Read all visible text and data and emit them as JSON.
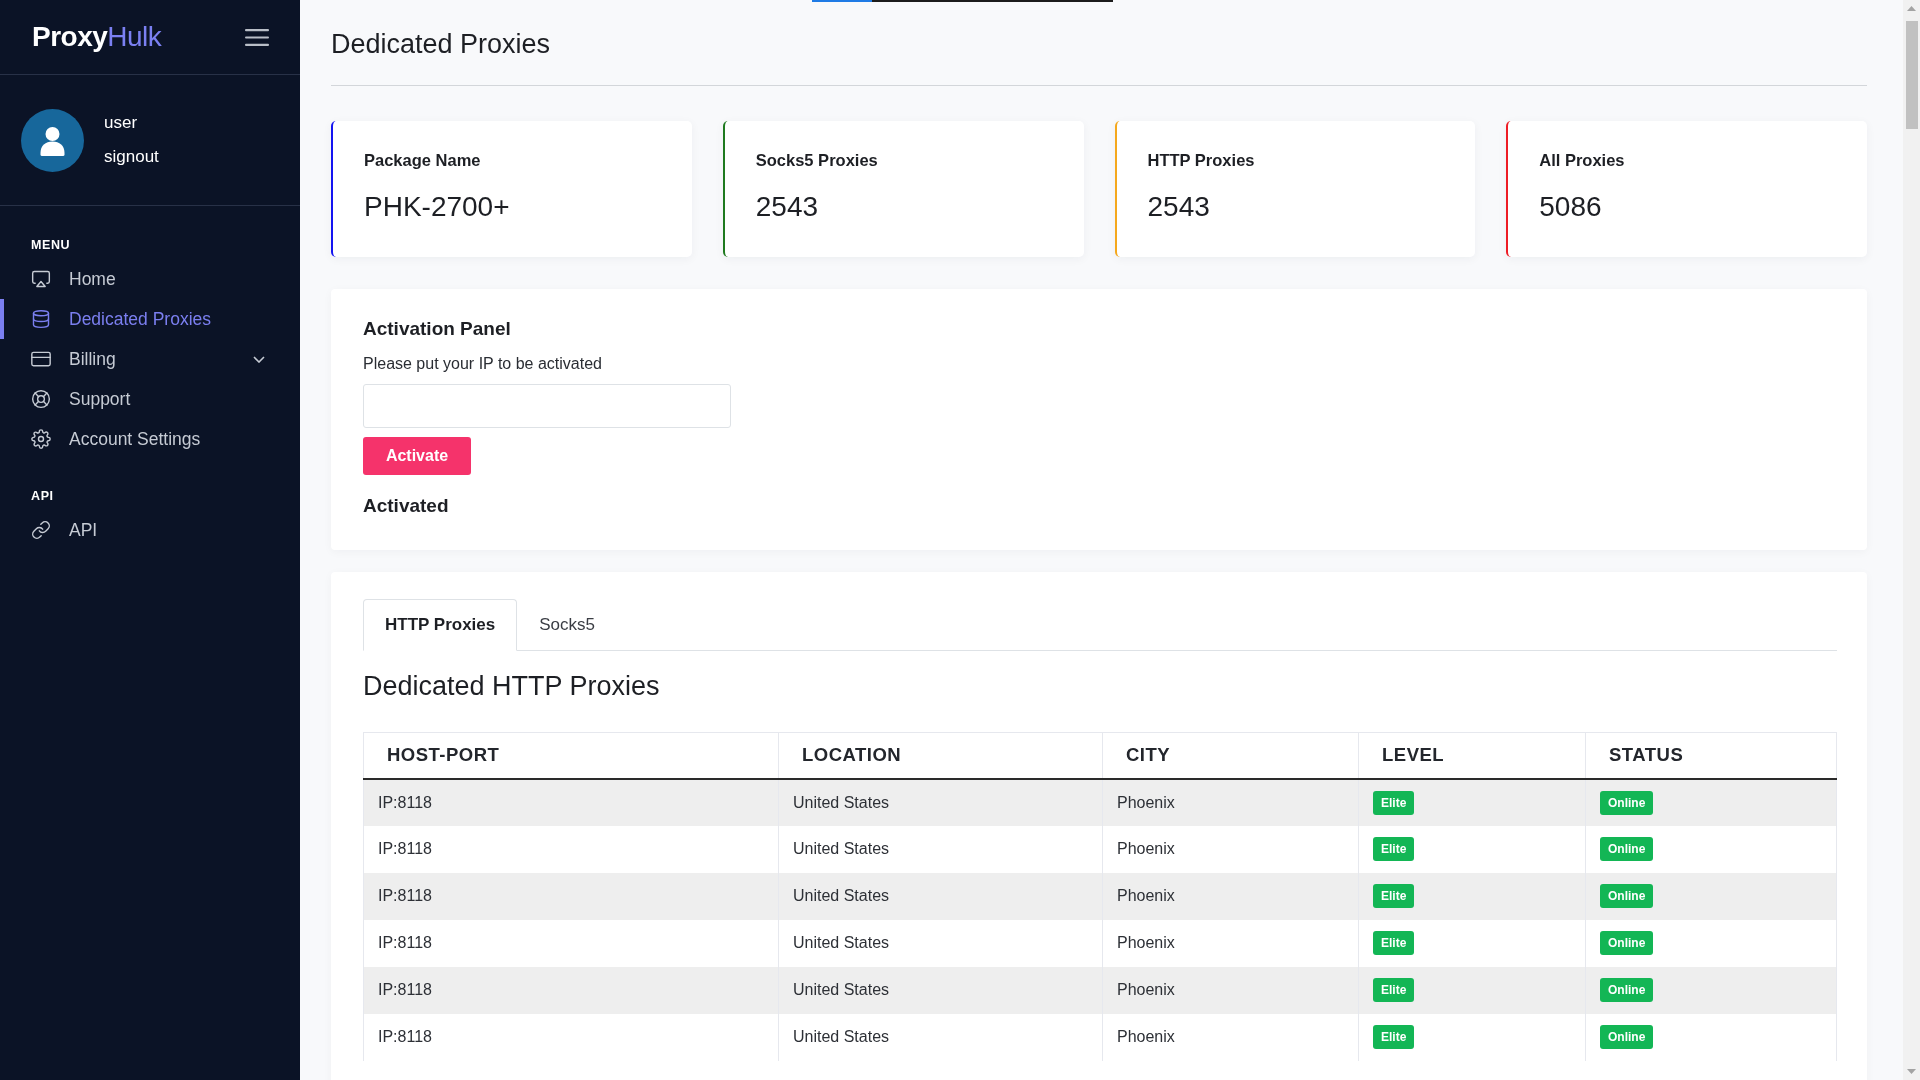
{
  "loading_bar": {
    "level": 0.2
  },
  "sidebar": {
    "logo": "**Proxy**Hulk",
    "user": {
      "name": "user",
      "signout": "signout"
    },
    "sections": [
      {
        "heading": "MENU",
        "items": [
          {
            "label": "Home",
            "kind": "link",
            "selected": false
          },
          {
            "label": "Dedicated Proxies",
            "kind": "link",
            "selected": true
          },
          {
            "label": "Billing",
            "kind": "group",
            "selected": false
          },
          {
            "label": "Support",
            "kind": "link",
            "selected": false
          },
          {
            "label": "Account Settings",
            "kind": "link",
            "selected": false
          }
        ]
      },
      {
        "heading": "API",
        "items": [
          {
            "label": "API",
            "kind": "link",
            "selected": false
          }
        ]
      }
    ]
  },
  "header": {
    "title": "Dedicated Proxies"
  },
  "stats": [
    {
      "label": "Package Name",
      "value": "PHK-2700+",
      "color": "#1414f0"
    },
    {
      "label": "Socks5 Proxies",
      "value": "2543",
      "color": "#1f7a1f"
    },
    {
      "label": "HTTP Proxies",
      "value": "2543",
      "color": "#f5a81c"
    },
    {
      "label": "All Proxies",
      "value": "5086",
      "color": "#ee1c25"
    }
  ],
  "activation_panel": {
    "title": "Activation Panel",
    "instruction": "Please put your IP to be activated",
    "button": "Activate",
    "status": "Activated"
  },
  "proxies_panel": {
    "tabs": [
      {
        "label": "HTTP Proxies",
        "selected": true
      },
      {
        "label": "Socks5",
        "selected": false
      }
    ],
    "title": "Dedicated HTTP Proxies",
    "table": {
      "columns": [
        "HOST-PORT",
        "LOCATION",
        "CITY",
        "LEVEL",
        "STATUS"
      ],
      "rows": [
        {
          "host_port": "IP:8118",
          "location": "United States",
          "city": "Phoenix",
          "level_badge": "Elite",
          "status_badge": "Online"
        },
        {
          "host_port": "IP:8118",
          "location": "United States",
          "city": "Phoenix",
          "level_badge": "Elite",
          "status_badge": "Online"
        },
        {
          "host_port": "IP:8118",
          "location": "United States",
          "city": "Phoenix",
          "level_badge": "Elite",
          "status_badge": "Online"
        },
        {
          "host_port": "IP:8118",
          "location": "United States",
          "city": "Phoenix",
          "level_badge": "Elite",
          "status_badge": "Online"
        },
        {
          "host_port": "IP:8118",
          "location": "United States",
          "city": "Phoenix",
          "level_badge": "Elite",
          "status_badge": "Online"
        },
        {
          "host_port": "IP:8118",
          "location": "United States",
          "city": "Phoenix",
          "level_badge": "Elite",
          "status_badge": "Online"
        }
      ]
    }
  }
}
